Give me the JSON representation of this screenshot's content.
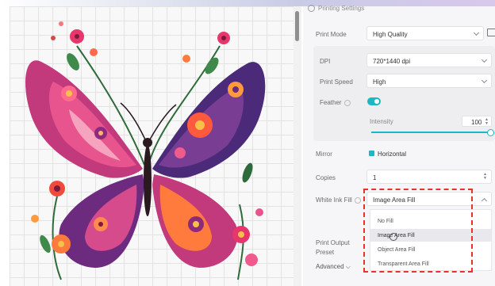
{
  "panel": {
    "section_title": "Printing Settings",
    "print_mode": {
      "label": "Print Mode",
      "value": "High Quality"
    },
    "dpi": {
      "label": "DPI",
      "value": "720*1440 dpi"
    },
    "print_speed": {
      "label": "Print Speed",
      "value": "High"
    },
    "feather": {
      "label": "Feather",
      "enabled": true
    },
    "intensity": {
      "label": "Intensity",
      "value": "100",
      "level_percent": 100
    },
    "mirror": {
      "label": "Mirror",
      "option": "Horizontal",
      "checked": true
    },
    "copies": {
      "label": "Copies",
      "value": "1"
    },
    "white_ink_fill": {
      "label": "White Ink Fill",
      "value": "Image Area Fill",
      "options": [
        "No Fill",
        "Image Area Fill",
        "Object Area Fill",
        "Transparent Area Fill"
      ],
      "highlighted": "Image Area Fill"
    },
    "print_output_preset": {
      "label_line1": "Print Output",
      "label_line2": "Preset"
    },
    "advanced": {
      "label": "Advanced"
    }
  },
  "colors": {
    "accent": "#19b8c4",
    "highlight_border": "#e8322e"
  },
  "canvas": {
    "image": "colorful floral butterfly illustration"
  }
}
